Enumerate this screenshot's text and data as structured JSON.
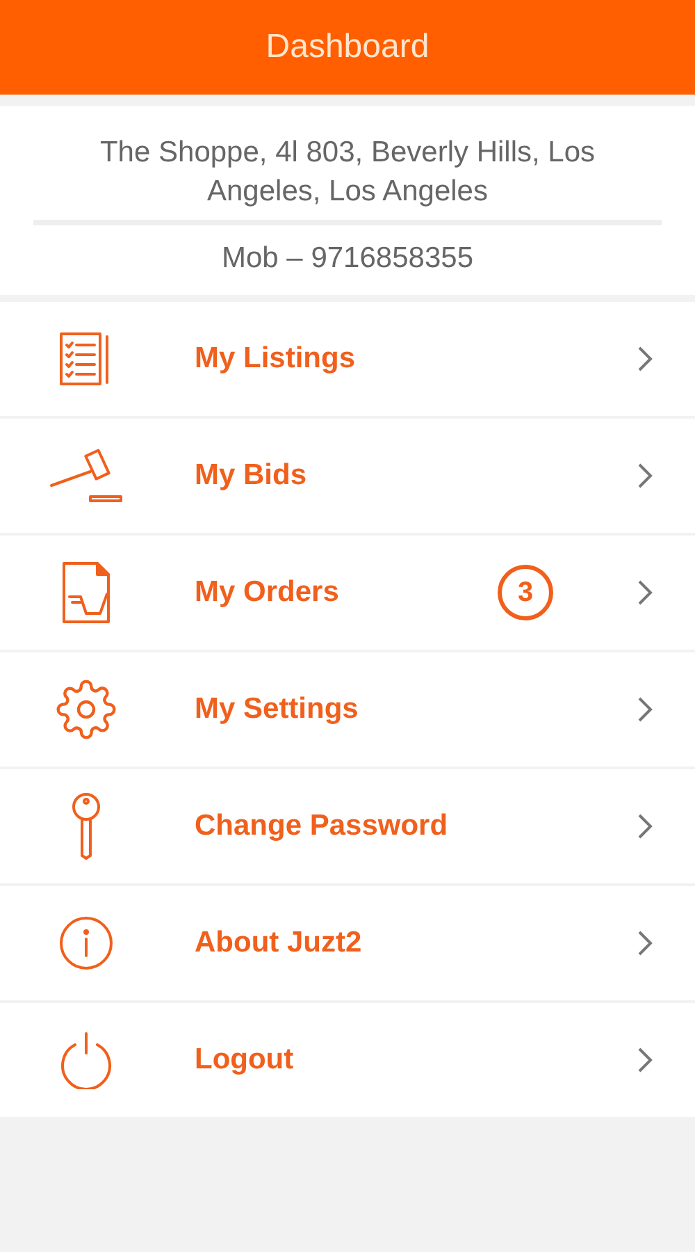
{
  "header": {
    "title": "Dashboard"
  },
  "profile": {
    "address": "The Shoppe, 4l 803, Beverly Hills, Los Angeles, Los Angeles",
    "phone": "Mob – 9716858355"
  },
  "menu": [
    {
      "kind": "listings",
      "label": "My Listings"
    },
    {
      "kind": "bids",
      "label": "My Bids"
    },
    {
      "kind": "orders",
      "label": "My Orders",
      "badge": "3"
    },
    {
      "kind": "settings",
      "label": "My Settings"
    },
    {
      "kind": "password",
      "label": "Change Password"
    },
    {
      "kind": "about",
      "label": "About Juzt2"
    },
    {
      "kind": "logout",
      "label": "Logout"
    }
  ]
}
